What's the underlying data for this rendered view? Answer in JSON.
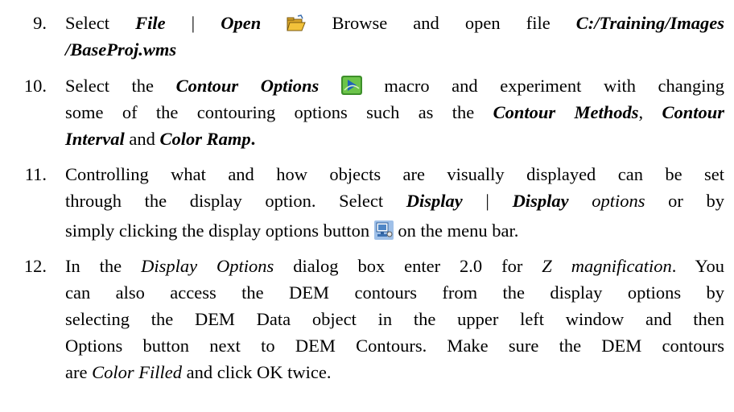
{
  "steps": [
    {
      "number": "9.",
      "lines": [
        {
          "t1": "Select ",
          "b1": "File",
          "t2": " | ",
          "b2": "Open",
          "t3": " Browse and open file ",
          "b3": "C:/Training/Images"
        },
        {
          "b1": "/BaseProj.wms"
        }
      ],
      "icon": "open-folder-icon"
    },
    {
      "number": "10.",
      "lines": [
        {
          "t1": "Select the ",
          "b1": "Contour Options",
          "t2": " macro and experiment with changing"
        },
        {
          "t1": "some of the contouring options such as the ",
          "b1": "Contour Methods",
          "t2": ", ",
          "b2": "Contour"
        },
        {
          "b1": "Interval",
          "t1": " and ",
          "b2": "Color Ramp",
          "t2": "."
        }
      ],
      "icon": "contour-options-macro-icon"
    },
    {
      "number": "11.",
      "lines": [
        {
          "t1": "Controlling what and how objects are visually displayed can be set"
        },
        {
          "t1": "through the display option. Select ",
          "b1": "Display",
          "t2": " | ",
          "b2": "Display",
          "i1": " options",
          "t3": " or by"
        },
        {
          "t1": "simply clicking the display options button ",
          "t2": " on the menu bar."
        }
      ],
      "icon": "display-options-icon"
    },
    {
      "number": "12.",
      "lines": [
        {
          "t1": "In the ",
          "i1": "Display Options",
          "t2": " dialog box enter 2.0 for ",
          "i2": "Z magnification",
          "t3": ". You"
        },
        {
          "t1": "can also access the DEM contours from the display options by"
        },
        {
          "t1": "selecting the DEM Data object in the upper left window and then"
        },
        {
          "t1": "Options button next to DEM Contours.  Make sure the DEM contours"
        },
        {
          "t1": "are ",
          "i1": "Color Filled",
          "t2": " and click OK twice."
        }
      ]
    }
  ],
  "colors": {
    "text": "#000000",
    "background": "#ffffff",
    "folder_yellow": "#f2c23a",
    "macro_green": "#5bbd3a",
    "display_blue": "#4f86c6"
  }
}
